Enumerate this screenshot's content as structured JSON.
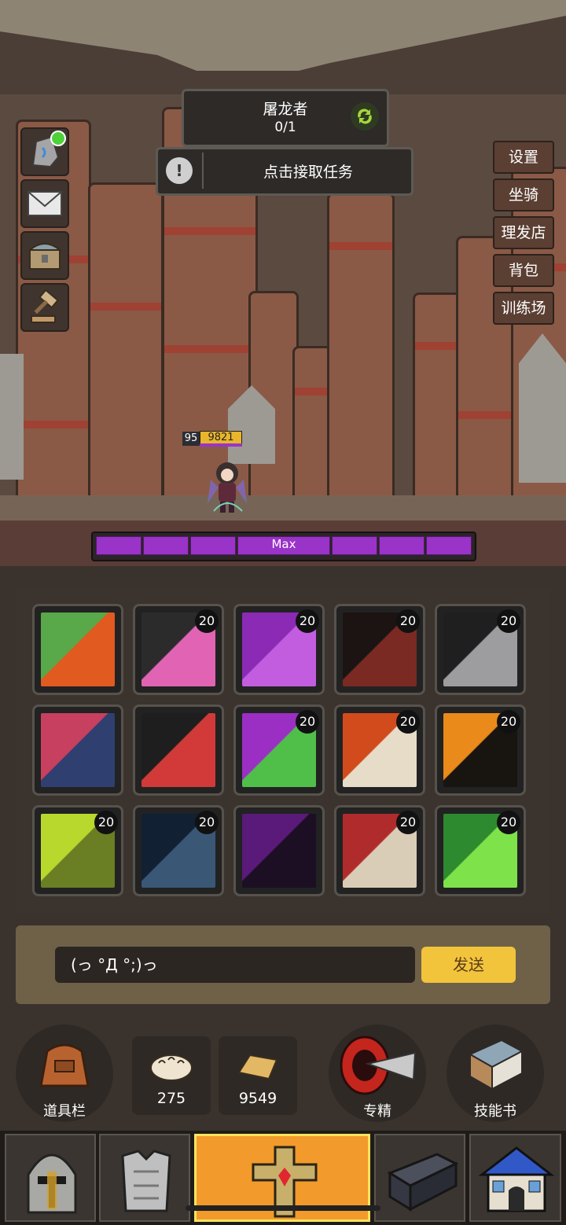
{
  "quest": {
    "title": "屠龙者",
    "progress": "0/1",
    "refresh_icon": "refresh-icon"
  },
  "task": {
    "label": "点击接取任务",
    "icon": "exclamation-icon"
  },
  "left_icons": [
    "rune-stone-icon",
    "mail-icon",
    "chest-icon",
    "auction-hammer-icon"
  ],
  "right_menu": [
    "设置",
    "坐骑",
    "理发店",
    "背包",
    "训练场"
  ],
  "player": {
    "level": "95",
    "xp": "9821"
  },
  "boss_bar": {
    "label": "Max"
  },
  "skills": [
    {
      "icon": "dragon-face-skill-icon",
      "level": ""
    },
    {
      "icon": "meteor-skill-icon",
      "level": "20"
    },
    {
      "icon": "purple-demon-skill-icon",
      "level": "20"
    },
    {
      "icon": "skull-helm-skill-icon",
      "level": "20"
    },
    {
      "icon": "ghost-grin-skill-icon",
      "level": "20"
    },
    {
      "icon": "hooded-figures-skill-icon",
      "level": ""
    },
    {
      "icon": "blade-strike-skill-icon",
      "level": ""
    },
    {
      "icon": "poison-sword-skill-icon",
      "level": "20"
    },
    {
      "icon": "shield-burst-skill-icon",
      "level": "20"
    },
    {
      "icon": "flame-shadow-skill-icon",
      "level": "20"
    },
    {
      "icon": "fist-skill-icon",
      "level": "20"
    },
    {
      "icon": "crack-night-skill-icon",
      "level": "20"
    },
    {
      "icon": "raven-skill-icon",
      "level": ""
    },
    {
      "icon": "red-cloak-skill-icon",
      "level": "20"
    },
    {
      "icon": "green-claw-skill-icon",
      "level": "20"
    }
  ],
  "chat": {
    "input_value": "(っ °Д °;)っ",
    "send_label": "发送"
  },
  "bottom": {
    "items_label": "道具栏",
    "bread_count": "275",
    "loaf_count": "9549",
    "mastery_label": "专精",
    "skillbook_label": "技能书"
  },
  "nav_tabs": [
    "helmet-tab-icon",
    "armor-tab-icon",
    "altar-tab-icon",
    "anvil-tab-icon",
    "shop-tab-icon"
  ],
  "colors": {
    "accent": "#f2c43b",
    "active_tab": "#f29a2b",
    "hp_bar": "#9a33c8"
  }
}
